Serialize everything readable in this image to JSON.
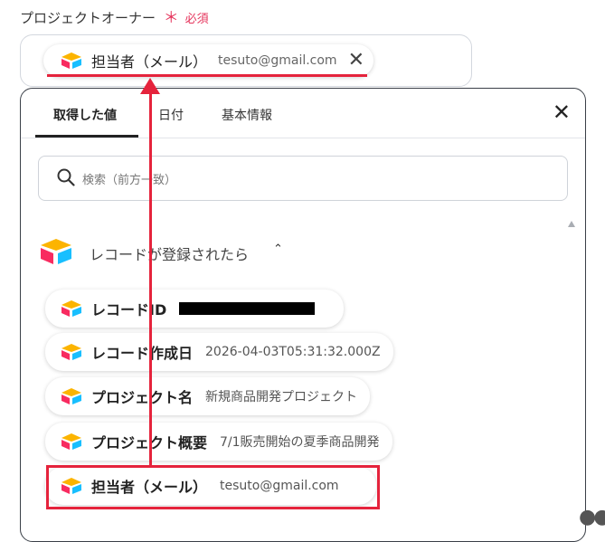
{
  "field": {
    "label": "プロジェクトオーナー",
    "asterisk": "＊",
    "required": "必須",
    "chip": {
      "label": "担当者（メール）",
      "value": "tesuto@gmail.com",
      "close": "✕"
    }
  },
  "panel": {
    "tabs": [
      {
        "label": "取得した値",
        "active": true
      },
      {
        "label": "日付",
        "active": false
      },
      {
        "label": "基本情報",
        "active": false
      }
    ],
    "close": "✕",
    "search": {
      "placeholder": "検索（前方一致）"
    },
    "section": {
      "title": "レコードが登録されたら",
      "caret": "⌃",
      "items": [
        {
          "label": "レコードID",
          "value": ""
        },
        {
          "label": "レコード作成日",
          "value": "2026-04-03T05:31:32.000Z"
        },
        {
          "label": "プロジェクト名",
          "value": "新規商品開発プロジェクト"
        },
        {
          "label": "プロジェクト概要",
          "value": "7/1販売開始の夏季商品開発"
        },
        {
          "label": "担当者（メール）",
          "value": "tesuto@gmail.com"
        }
      ]
    }
  },
  "colors": {
    "accent_red": "#e5233c",
    "required_pink": "#e5335b",
    "airtable_yellow": "#fcb400",
    "airtable_blue": "#18bfff",
    "airtable_red": "#f82b60"
  },
  "icons": {
    "app": "airtable-logo-icon",
    "search": "search-icon",
    "close": "close-icon",
    "collapse": "chevron-up-icon"
  },
  "more": "●●"
}
